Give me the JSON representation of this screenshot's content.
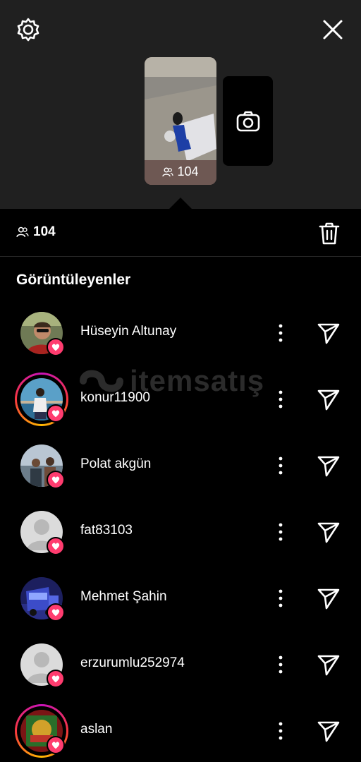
{
  "header": {
    "settings_icon": "settings-icon",
    "close_icon": "close-icon",
    "story_viewer_count": "104",
    "camera_icon": "camera-icon"
  },
  "stats": {
    "viewer_count": "104",
    "trash_icon": "trash-icon"
  },
  "section_title": "Görüntüleyenler",
  "viewers": [
    {
      "name": "Hüseyin Altunay",
      "story_ring": false
    },
    {
      "name": "konur11900",
      "story_ring": true
    },
    {
      "name": "Polat akgün",
      "story_ring": false
    },
    {
      "name": "fat83103",
      "story_ring": false
    },
    {
      "name": "Mehmet Şahin",
      "story_ring": false
    },
    {
      "name": "erzurumlu252974",
      "story_ring": false
    },
    {
      "name": "aslan",
      "story_ring": true
    }
  ],
  "watermark": "itemsatış",
  "colors": {
    "top_bg": "#202020",
    "bg": "#000000",
    "heart": "#ff3c6f"
  }
}
